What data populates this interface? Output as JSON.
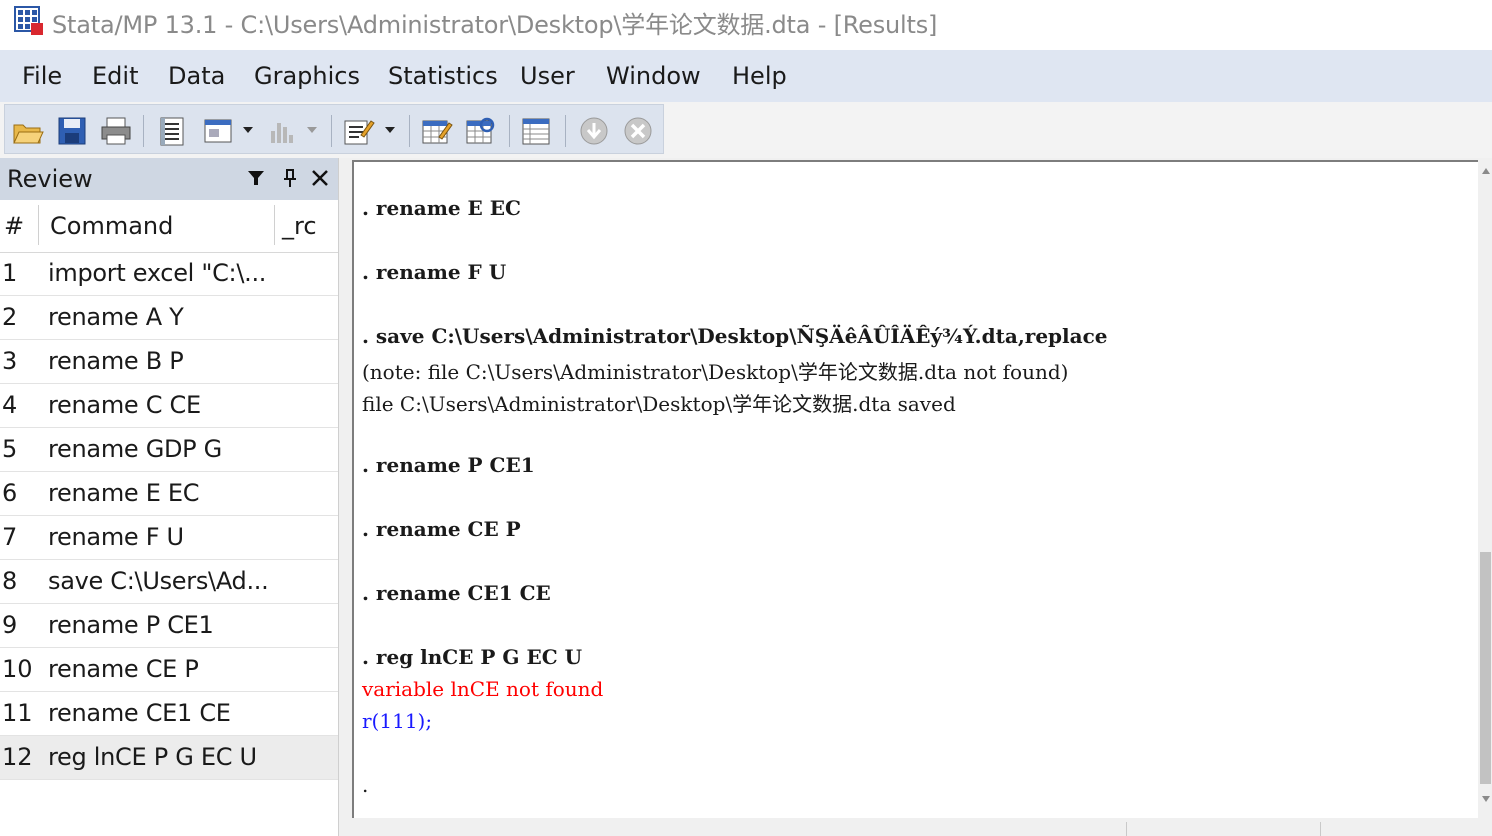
{
  "window": {
    "title": "Stata/MP 13.1 - C:\\Users\\Administrator\\Desktop\\学年论文数据.dta - [Results]",
    "app_icon": "stata-app-icon"
  },
  "menu": [
    "File",
    "Edit",
    "Data",
    "Graphics",
    "Statistics",
    "User",
    "Window",
    "Help"
  ],
  "toolbar": {
    "icons": [
      "open-icon",
      "save-icon",
      "print-icon",
      "log-icon",
      "viewer-icon",
      "graph-icon",
      "do-file-editor-icon",
      "data-editor-icon",
      "data-browser-icon",
      "variables-manager-icon",
      "more-icon",
      "break-icon"
    ]
  },
  "review": {
    "title": "Review",
    "col_num": "#",
    "col_command": "Command",
    "col_rc": "_rc",
    "rows": [
      {
        "num": "1",
        "command": "import excel \"C:\\..."
      },
      {
        "num": "2",
        "command": "rename A Y"
      },
      {
        "num": "3",
        "command": "rename B P"
      },
      {
        "num": "4",
        "command": "rename C CE"
      },
      {
        "num": "5",
        "command": "rename GDP G"
      },
      {
        "num": "6",
        "command": "rename E EC"
      },
      {
        "num": "7",
        "command": "rename F U"
      },
      {
        "num": "8",
        "command": "save C:\\Users\\Ad..."
      },
      {
        "num": "9",
        "command": "rename P CE1"
      },
      {
        "num": "10",
        "command": "rename CE P"
      },
      {
        "num": "11",
        "command": "rename CE1 CE"
      },
      {
        "num": "12",
        "command": "reg lnCE P G EC U"
      }
    ]
  },
  "results": {
    "lines": [
      {
        "text": ". rename E EC",
        "kind": "cmd"
      },
      {
        "text": ". rename F U",
        "kind": "cmd"
      },
      {
        "text": ". save C:\\Users\\Administrator\\Desktop\\ÑŞÄêÂÛÎÄÊý¾Ý.dta,replace",
        "kind": "cmd"
      },
      {
        "text": "(note: file C:\\Users\\Administrator\\Desktop\\学年论文数据.dta not found)",
        "kind": "out"
      },
      {
        "text": "file C:\\Users\\Administrator\\Desktop\\学年论文数据.dta saved",
        "kind": "out"
      },
      {
        "text": ". rename P CE1",
        "kind": "cmd"
      },
      {
        "text": ". rename CE P",
        "kind": "cmd"
      },
      {
        "text": ". rename CE1 CE",
        "kind": "cmd"
      },
      {
        "text": ". reg lnCE P G EC U",
        "kind": "cmd"
      },
      {
        "text": "variable lnCE not found",
        "kind": "err"
      },
      {
        "text": "r(111);",
        "kind": "link"
      },
      {
        "text": ".",
        "kind": "out"
      }
    ]
  }
}
